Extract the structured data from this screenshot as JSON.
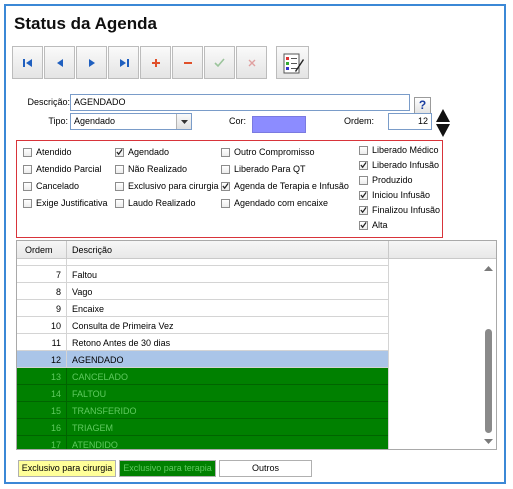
{
  "window": {
    "title": "Status da Agenda"
  },
  "toolbar": {
    "buttons": [
      {
        "name": "first-record-button",
        "icon": "first-icon"
      },
      {
        "name": "previous-record-button",
        "icon": "previous-icon"
      },
      {
        "name": "next-record-button",
        "icon": "next-icon"
      },
      {
        "name": "last-record-button",
        "icon": "last-icon"
      },
      {
        "name": "add-button",
        "icon": "plus-icon"
      },
      {
        "name": "delete-button",
        "icon": "minus-icon"
      },
      {
        "name": "confirm-button",
        "icon": "check-icon"
      },
      {
        "name": "cancel-button",
        "icon": "close-icon"
      },
      {
        "name": "report-button",
        "icon": "form-edit-icon"
      }
    ]
  },
  "form": {
    "descricao_label": "Descrição:",
    "descricao_value": "AGENDADO",
    "help_label": "?",
    "tipo_label": "Tipo:",
    "tipo_value": "Agendado",
    "cor_label": "Cor:",
    "cor_value": "#8c8cff",
    "ordem_label": "Ordem:",
    "ordem_value": "12"
  },
  "checkboxes": [
    {
      "label": "Atendido",
      "checked": false
    },
    {
      "label": "Atendido Parcial",
      "checked": false
    },
    {
      "label": "Cancelado",
      "checked": false
    },
    {
      "label": "Exige Justificativa",
      "checked": false
    },
    {
      "label": "Agendado",
      "checked": true
    },
    {
      "label": "Não Realizado",
      "checked": false
    },
    {
      "label": "Exclusivo para cirurgia",
      "checked": false
    },
    {
      "label": "Laudo Realizado",
      "checked": false
    },
    {
      "label": "Outro Compromisso",
      "checked": false
    },
    {
      "label": "Liberado Para QT",
      "checked": false
    },
    {
      "label": "Agenda de Terapia e Infusão",
      "checked": true
    },
    {
      "label": "Agendado com encaixe",
      "checked": false
    },
    {
      "label": "Liberado Médico",
      "checked": false
    },
    {
      "label": "Liberado Infusão",
      "checked": true
    },
    {
      "label": "Produzido",
      "checked": false
    },
    {
      "label": "Iniciou Infusão",
      "checked": true
    },
    {
      "label": "Finalizou Infusão",
      "checked": true
    },
    {
      "label": "Alta",
      "checked": true
    }
  ],
  "grid": {
    "columns": [
      "Ordem",
      "Descrição"
    ],
    "rows": [
      {
        "ordem": "7",
        "descricao": "Faltou",
        "style": "normal"
      },
      {
        "ordem": "8",
        "descricao": "Vago",
        "style": "normal"
      },
      {
        "ordem": "9",
        "descricao": "Encaixe",
        "style": "normal"
      },
      {
        "ordem": "10",
        "descricao": "Consulta de Primeira Vez",
        "style": "normal"
      },
      {
        "ordem": "11",
        "descricao": "Retono Antes de 30 dias",
        "style": "normal"
      },
      {
        "ordem": "12",
        "descricao": "AGENDADO",
        "style": "selected"
      },
      {
        "ordem": "13",
        "descricao": "CANCELADO",
        "style": "green"
      },
      {
        "ordem": "14",
        "descricao": "FALTOU",
        "style": "green"
      },
      {
        "ordem": "15",
        "descricao": "TRANSFERIDO",
        "style": "green"
      },
      {
        "ordem": "16",
        "descricao": "TRIAGEM",
        "style": "green"
      },
      {
        "ordem": "17",
        "descricao": "ATENDIDO",
        "style": "green"
      }
    ]
  },
  "legend": {
    "items": [
      {
        "label": "Exclusivo para cirurgia",
        "bg": "#ffff99",
        "fg": "#000000"
      },
      {
        "label": "Exclusivo para terapia",
        "bg": "#008000",
        "fg": "#5fc95f"
      },
      {
        "label": "Outros",
        "bg": "#ffffff",
        "fg": "#000000"
      }
    ]
  },
  "colors": {
    "accent_border": "#3b88d6",
    "group_border": "#d8343a",
    "selected_row": "#aac5e8",
    "therapy_green": "#008000"
  }
}
